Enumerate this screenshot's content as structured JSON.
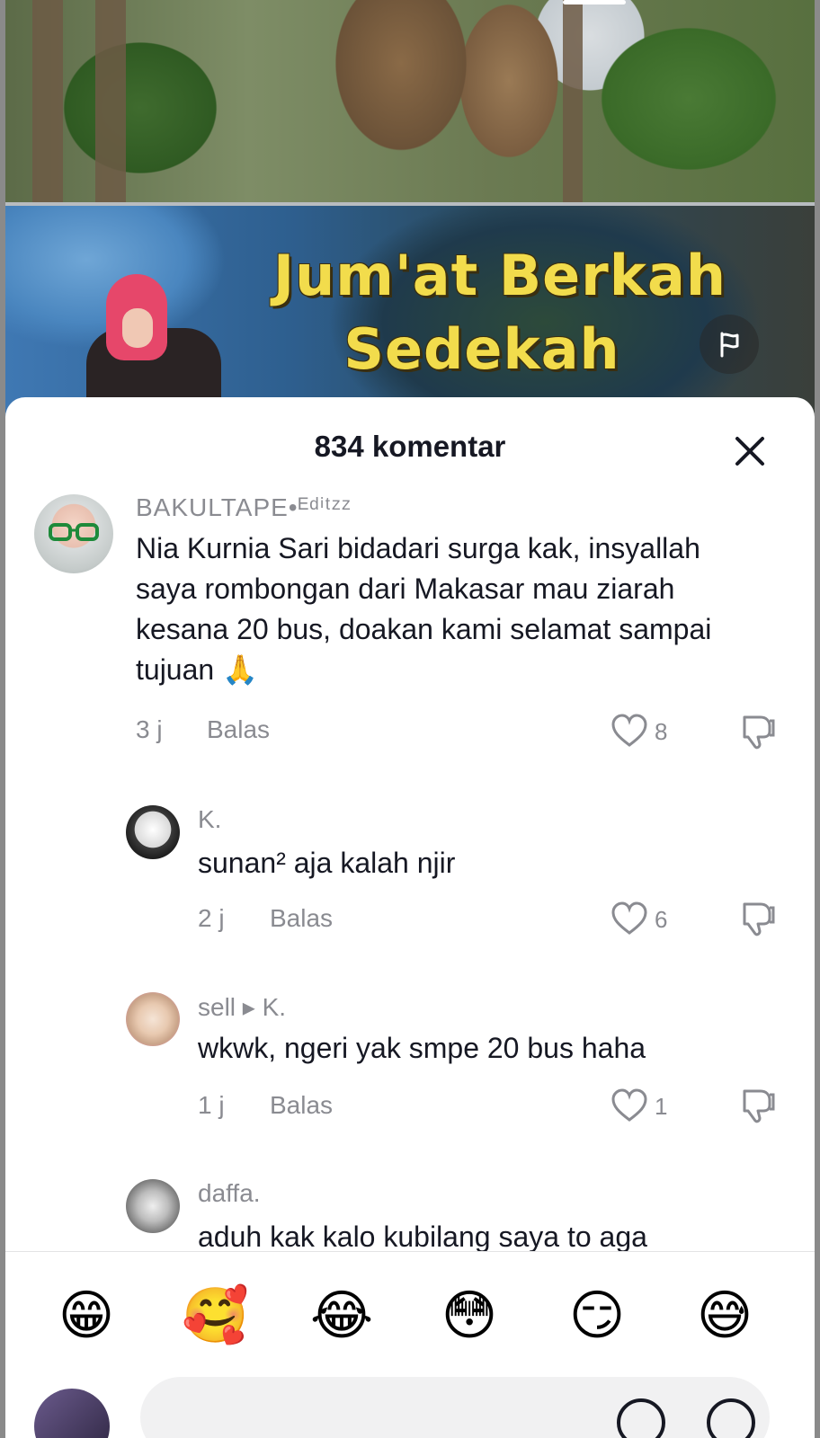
{
  "video": {
    "banner_line1": "Jum'at Berkah",
    "banner_line2": "Sedekah"
  },
  "sheet": {
    "title": "834 komentar"
  },
  "comments": [
    {
      "username": "BAKULTAPE•ᴱᵈⁱᵗᶻᶻ",
      "text": "Nia Kurnia Sari bidadari surga kak, insyallah saya rombongan dari Makasar mau ziarah kesana 20 bus, doakan kami selamat sampai tujuan 🙏",
      "time": "3 j",
      "reply_label": "Balas",
      "likes": "8"
    },
    {
      "username": "K.",
      "text": "sunan² aja kalah njir",
      "time": "2 j",
      "reply_label": "Balas",
      "likes": "6"
    },
    {
      "username": "sell ▸ K.",
      "text": "wkwk, ngeri yak smpe 20 bus haha",
      "time": "1 j",
      "reply_label": "Balas",
      "likes": "1"
    },
    {
      "username": "daffa.",
      "text": "aduh kak kalo kubilang saya to aga"
    }
  ],
  "emoji_bar": [
    "😁",
    "🥰",
    "😂",
    "😳",
    "😏",
    "😅"
  ],
  "colors": {
    "text_primary": "#161823",
    "text_secondary": "#8a8b91",
    "banner_yellow": "#f2dc4c"
  },
  "icons": [
    "flag-icon",
    "close-icon",
    "heart-icon",
    "dislike-icon"
  ]
}
